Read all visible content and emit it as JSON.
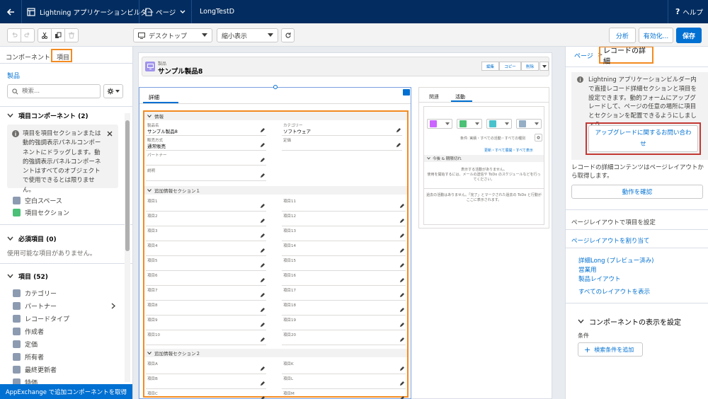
{
  "topbar": {
    "app_title": "Lightning アプリケーションビルダー",
    "page_menu": "ページ",
    "record_name": "LongTestD",
    "help": "ヘルプ"
  },
  "toolbar": {
    "device_select": "デスクトップ",
    "view_select": "縮小表示",
    "analyze": "分析",
    "activate": "有効化...",
    "save": "保存"
  },
  "left": {
    "tabs": [
      "コンポーネント",
      "項目"
    ],
    "object_name": "製品",
    "search_placeholder": "検索...",
    "field_components_title": "項目コンポーネント (2)",
    "info_text": "項目を項目セクションまたは動的強調表示パネルコンポーネントにドラッグします。動的強調表示パネルコンポーネントはすべてのオブジェクトで使用できるとは限りません。",
    "components": [
      "空白スペース",
      "項目セクション"
    ],
    "required_title": "必須項目 (0)",
    "required_empty": "使用可能な項目がありません。",
    "fields_title": "項目 (52)",
    "fields": [
      "カテゴリー",
      "パートナー",
      "レコードタイプ",
      "作成者",
      "定価",
      "所有者",
      "最終更新者",
      "特価"
    ],
    "appexchange": "AppExchange で追加コンポーネントを取得"
  },
  "canvas": {
    "object_label": "製品",
    "record_title": "サンプル製品8",
    "header_buttons": [
      "編集",
      "コピー",
      "削除"
    ],
    "detail_tab": "詳細",
    "section_info": "情報",
    "info_fields": [
      {
        "label": "製品名",
        "value": "サンプル製品8"
      },
      {
        "label": "カテゴリー",
        "value": "ソフトウェア"
      },
      {
        "label": "販売方式",
        "value": "通常販売"
      },
      {
        "label": "定価",
        "value": ""
      },
      {
        "label": "パートナー",
        "value": ""
      },
      {
        "label": "説明",
        "value": ""
      }
    ],
    "section_add1": "追加情報セクション１",
    "add1_left": [
      "項目1",
      "項目2",
      "項目3",
      "項目4",
      "項目5",
      "項目6",
      "項目7",
      "項目8",
      "項目9",
      "項目10"
    ],
    "add1_right": [
      "項目11",
      "項目12",
      "項目13",
      "項目14",
      "項目15",
      "項目16",
      "項目17",
      "項目18",
      "項目19",
      "項目20"
    ],
    "section_add2": "追加情報セクション２",
    "add2_left": [
      "項目A",
      "項目B",
      "項目C"
    ],
    "add2_right": [
      "項目K",
      "項目L",
      "項目M"
    ],
    "activity_tabs": [
      "関連",
      "活動"
    ],
    "filter_text": "条件: 実績・すべての活動・すべての種別",
    "refresh_links": "更新・すべて展開・すべて表示",
    "upcoming_title": "今後 & 期限切れ",
    "no_activity": "表示する活動がありません。",
    "activity_hint": "使用を開始するには、メールの送信や ToDo のスケジュールなどを行ってください。",
    "past_text": "過去の活動はありません。「完了」とマークされた過去の ToDo と行動がここに表示されます。"
  },
  "right": {
    "breadcrumb_page": "ページ",
    "breadcrumb_sep": ">",
    "title": "レコードの詳細",
    "info_text": "Lightning アプリケーションビルダー内で直接レコード詳細セクションと項目を設定できます。動的フォームにアップグレードして、ページの任意の場所に項目とセクションを配置できるようにしましょう。",
    "upgrade_link": "アップグレードに関するお問い合わせ",
    "layout_text": "レコードの詳細コンテンツはページレイアウトから取得します。",
    "how_it_works": "動作を確認",
    "set_fields": "ページレイアウトで項目を設定",
    "assign_layout": "ページレイアウトを割り当て",
    "layouts": [
      "詳細Long (プレビュー済み)",
      "営業用",
      "製品レイアウト"
    ],
    "all_layouts": "すべてのレイアウトを表示",
    "visibility_title": "コンポーネントの表示を設定",
    "conditions_label": "条件",
    "add_filter": "検索条件を追加"
  },
  "colors": {
    "topbar": "#032d60",
    "highlight": "#f38b21",
    "brand_blue": "#0070d2",
    "red_box": "#c23934"
  }
}
